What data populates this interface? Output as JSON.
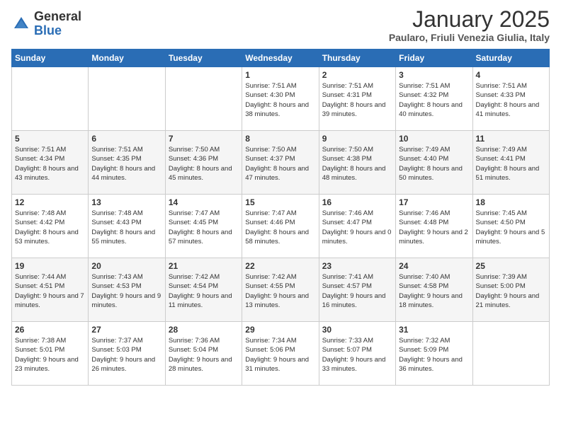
{
  "logo": {
    "general": "General",
    "blue": "Blue"
  },
  "header": {
    "month": "January 2025",
    "location": "Paularo, Friuli Venezia Giulia, Italy"
  },
  "weekdays": [
    "Sunday",
    "Monday",
    "Tuesday",
    "Wednesday",
    "Thursday",
    "Friday",
    "Saturday"
  ],
  "weeks": [
    [
      {
        "day": "",
        "info": ""
      },
      {
        "day": "",
        "info": ""
      },
      {
        "day": "",
        "info": ""
      },
      {
        "day": "1",
        "info": "Sunrise: 7:51 AM\nSunset: 4:30 PM\nDaylight: 8 hours\nand 38 minutes."
      },
      {
        "day": "2",
        "info": "Sunrise: 7:51 AM\nSunset: 4:31 PM\nDaylight: 8 hours\nand 39 minutes."
      },
      {
        "day": "3",
        "info": "Sunrise: 7:51 AM\nSunset: 4:32 PM\nDaylight: 8 hours\nand 40 minutes."
      },
      {
        "day": "4",
        "info": "Sunrise: 7:51 AM\nSunset: 4:33 PM\nDaylight: 8 hours\nand 41 minutes."
      }
    ],
    [
      {
        "day": "5",
        "info": "Sunrise: 7:51 AM\nSunset: 4:34 PM\nDaylight: 8 hours\nand 43 minutes."
      },
      {
        "day": "6",
        "info": "Sunrise: 7:51 AM\nSunset: 4:35 PM\nDaylight: 8 hours\nand 44 minutes."
      },
      {
        "day": "7",
        "info": "Sunrise: 7:50 AM\nSunset: 4:36 PM\nDaylight: 8 hours\nand 45 minutes."
      },
      {
        "day": "8",
        "info": "Sunrise: 7:50 AM\nSunset: 4:37 PM\nDaylight: 8 hours\nand 47 minutes."
      },
      {
        "day": "9",
        "info": "Sunrise: 7:50 AM\nSunset: 4:38 PM\nDaylight: 8 hours\nand 48 minutes."
      },
      {
        "day": "10",
        "info": "Sunrise: 7:49 AM\nSunset: 4:40 PM\nDaylight: 8 hours\nand 50 minutes."
      },
      {
        "day": "11",
        "info": "Sunrise: 7:49 AM\nSunset: 4:41 PM\nDaylight: 8 hours\nand 51 minutes."
      }
    ],
    [
      {
        "day": "12",
        "info": "Sunrise: 7:48 AM\nSunset: 4:42 PM\nDaylight: 8 hours\nand 53 minutes."
      },
      {
        "day": "13",
        "info": "Sunrise: 7:48 AM\nSunset: 4:43 PM\nDaylight: 8 hours\nand 55 minutes."
      },
      {
        "day": "14",
        "info": "Sunrise: 7:47 AM\nSunset: 4:45 PM\nDaylight: 8 hours\nand 57 minutes."
      },
      {
        "day": "15",
        "info": "Sunrise: 7:47 AM\nSunset: 4:46 PM\nDaylight: 8 hours\nand 58 minutes."
      },
      {
        "day": "16",
        "info": "Sunrise: 7:46 AM\nSunset: 4:47 PM\nDaylight: 9 hours\nand 0 minutes."
      },
      {
        "day": "17",
        "info": "Sunrise: 7:46 AM\nSunset: 4:48 PM\nDaylight: 9 hours\nand 2 minutes."
      },
      {
        "day": "18",
        "info": "Sunrise: 7:45 AM\nSunset: 4:50 PM\nDaylight: 9 hours\nand 5 minutes."
      }
    ],
    [
      {
        "day": "19",
        "info": "Sunrise: 7:44 AM\nSunset: 4:51 PM\nDaylight: 9 hours\nand 7 minutes."
      },
      {
        "day": "20",
        "info": "Sunrise: 7:43 AM\nSunset: 4:53 PM\nDaylight: 9 hours\nand 9 minutes."
      },
      {
        "day": "21",
        "info": "Sunrise: 7:42 AM\nSunset: 4:54 PM\nDaylight: 9 hours\nand 11 minutes."
      },
      {
        "day": "22",
        "info": "Sunrise: 7:42 AM\nSunset: 4:55 PM\nDaylight: 9 hours\nand 13 minutes."
      },
      {
        "day": "23",
        "info": "Sunrise: 7:41 AM\nSunset: 4:57 PM\nDaylight: 9 hours\nand 16 minutes."
      },
      {
        "day": "24",
        "info": "Sunrise: 7:40 AM\nSunset: 4:58 PM\nDaylight: 9 hours\nand 18 minutes."
      },
      {
        "day": "25",
        "info": "Sunrise: 7:39 AM\nSunset: 5:00 PM\nDaylight: 9 hours\nand 21 minutes."
      }
    ],
    [
      {
        "day": "26",
        "info": "Sunrise: 7:38 AM\nSunset: 5:01 PM\nDaylight: 9 hours\nand 23 minutes."
      },
      {
        "day": "27",
        "info": "Sunrise: 7:37 AM\nSunset: 5:03 PM\nDaylight: 9 hours\nand 26 minutes."
      },
      {
        "day": "28",
        "info": "Sunrise: 7:36 AM\nSunset: 5:04 PM\nDaylight: 9 hours\nand 28 minutes."
      },
      {
        "day": "29",
        "info": "Sunrise: 7:34 AM\nSunset: 5:06 PM\nDaylight: 9 hours\nand 31 minutes."
      },
      {
        "day": "30",
        "info": "Sunrise: 7:33 AM\nSunset: 5:07 PM\nDaylight: 9 hours\nand 33 minutes."
      },
      {
        "day": "31",
        "info": "Sunrise: 7:32 AM\nSunset: 5:09 PM\nDaylight: 9 hours\nand 36 minutes."
      },
      {
        "day": "",
        "info": ""
      }
    ]
  ]
}
